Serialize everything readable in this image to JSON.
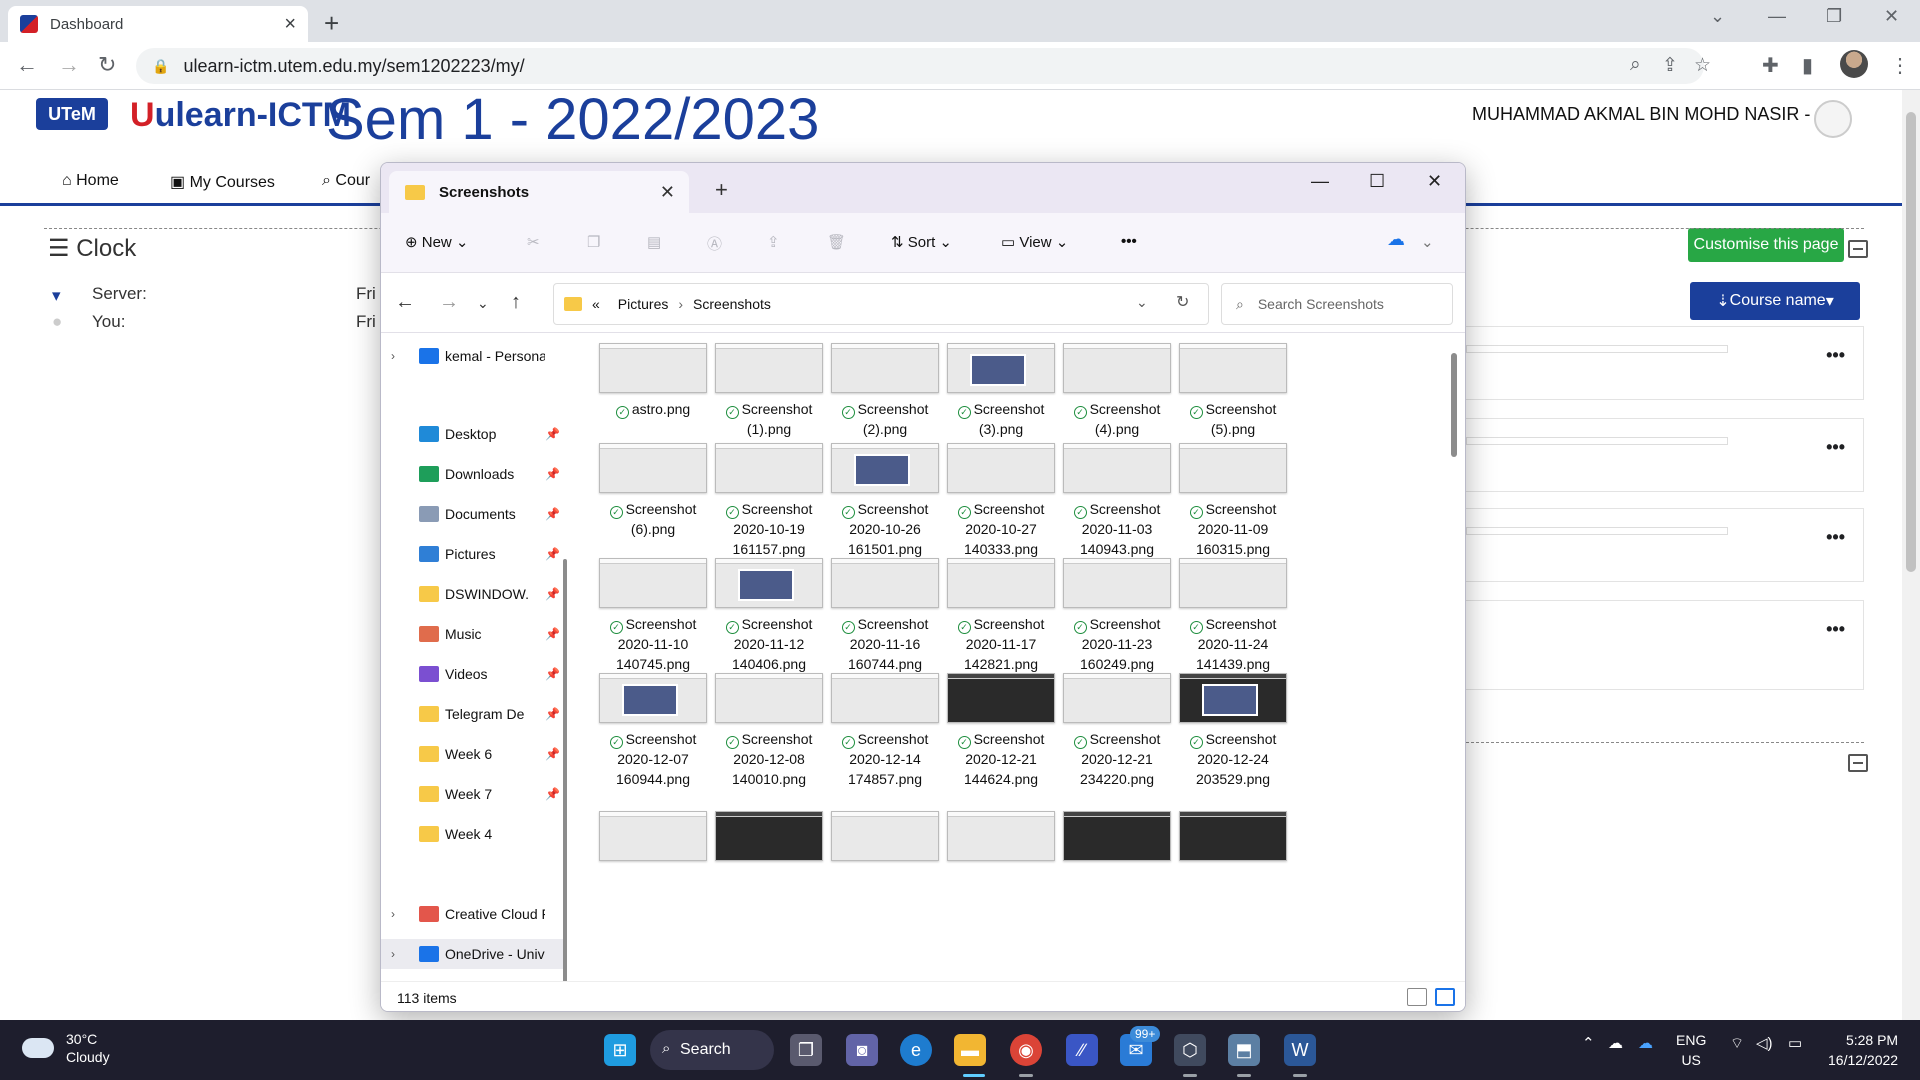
{
  "browser": {
    "tab_title": "Dashboard",
    "new_tab": "+",
    "url": "ulearn-ictm.utem.edu.my/sem1202223/my/"
  },
  "site": {
    "logo_text": "UTeM",
    "brand": "ulearn-ICTM",
    "brand_mark": "U",
    "semester_title": "Sem 1 - 2022/2023",
    "user_name": "MUHAMMAD AKMAL BIN MOHD NASIR -",
    "menu": [
      "Home",
      "My Courses",
      "Cour"
    ],
    "customise_label": "Customise this page",
    "clock": {
      "title": "Clock",
      "server_label": "Server:",
      "server_value": "Fri",
      "you_label": "You:",
      "you_value": "Fri"
    },
    "sort_label": "Course name",
    "course_more": "•••"
  },
  "explorer": {
    "tab_title": "Screenshots",
    "commands": {
      "new": "New",
      "sort": "Sort",
      "view": "View",
      "more": "•••"
    },
    "breadcrumb": {
      "prefix": "«",
      "parent": "Pictures",
      "current": "Screenshots"
    },
    "search_placeholder": "Search Screenshots",
    "nav": [
      {
        "label": "kemal - Persona",
        "color": "#1a73e8",
        "chev": true,
        "pin": false
      },
      {
        "label": "Desktop",
        "color": "#1f8ad8",
        "chev": false,
        "pin": true
      },
      {
        "label": "Downloads",
        "color": "#1e9e5a",
        "chev": false,
        "pin": true
      },
      {
        "label": "Documents",
        "color": "#8a9bb5",
        "chev": false,
        "pin": true
      },
      {
        "label": "Pictures",
        "color": "#2f7fd6",
        "chev": false,
        "pin": true
      },
      {
        "label": "DSWINDOW.",
        "color": "#f7c948",
        "chev": false,
        "pin": true
      },
      {
        "label": "Music",
        "color": "#e06c4c",
        "chev": false,
        "pin": true
      },
      {
        "label": "Videos",
        "color": "#7b4fd1",
        "chev": false,
        "pin": true
      },
      {
        "label": "Telegram De",
        "color": "#f7c948",
        "chev": false,
        "pin": true
      },
      {
        "label": "Week 6",
        "color": "#f7c948",
        "chev": false,
        "pin": true
      },
      {
        "label": "Week 7",
        "color": "#f7c948",
        "chev": false,
        "pin": true
      },
      {
        "label": "Week 4",
        "color": "#f7c948",
        "chev": false,
        "pin": false
      },
      {
        "label": "Creative Cloud F",
        "color": "#e3564b",
        "chev": true,
        "pin": false
      },
      {
        "label": "OneDrive - Univ",
        "color": "#1a73e8",
        "chev": true,
        "pin": false
      }
    ],
    "files": [
      {
        "l1": "astro.png",
        "l2": "",
        "l3": "",
        "dark": false
      },
      {
        "l1": "Screenshot",
        "l2": "(1).png",
        "l3": "",
        "dark": false
      },
      {
        "l1": "Screenshot",
        "l2": "(2).png",
        "l3": "",
        "dark": false
      },
      {
        "l1": "Screenshot",
        "l2": "(3).png",
        "l3": "",
        "dark": false
      },
      {
        "l1": "Screenshot",
        "l2": "(4).png",
        "l3": "",
        "dark": false
      },
      {
        "l1": "Screenshot",
        "l2": "(5).png",
        "l3": "",
        "dark": false
      },
      {
        "l1": "Screenshot",
        "l2": "(6).png",
        "l3": "",
        "dark": false
      },
      {
        "l1": "Screenshot",
        "l2": "2020-10-19",
        "l3": "161157.png",
        "dark": false
      },
      {
        "l1": "Screenshot",
        "l2": "2020-10-26",
        "l3": "161501.png",
        "dark": false
      },
      {
        "l1": "Screenshot",
        "l2": "2020-10-27",
        "l3": "140333.png",
        "dark": false
      },
      {
        "l1": "Screenshot",
        "l2": "2020-11-03",
        "l3": "140943.png",
        "dark": false
      },
      {
        "l1": "Screenshot",
        "l2": "2020-11-09",
        "l3": "160315.png",
        "dark": false
      },
      {
        "l1": "Screenshot",
        "l2": "2020-11-10",
        "l3": "140745.png",
        "dark": false
      },
      {
        "l1": "Screenshot",
        "l2": "2020-11-12",
        "l3": "140406.png",
        "dark": false
      },
      {
        "l1": "Screenshot",
        "l2": "2020-11-16",
        "l3": "160744.png",
        "dark": false
      },
      {
        "l1": "Screenshot",
        "l2": "2020-11-17",
        "l3": "142821.png",
        "dark": false
      },
      {
        "l1": "Screenshot",
        "l2": "2020-11-23",
        "l3": "160249.png",
        "dark": false
      },
      {
        "l1": "Screenshot",
        "l2": "2020-11-24",
        "l3": "141439.png",
        "dark": false
      },
      {
        "l1": "Screenshot",
        "l2": "2020-12-07",
        "l3": "160944.png",
        "dark": false
      },
      {
        "l1": "Screenshot",
        "l2": "2020-12-08",
        "l3": "140010.png",
        "dark": false
      },
      {
        "l1": "Screenshot",
        "l2": "2020-12-14",
        "l3": "174857.png",
        "dark": false
      },
      {
        "l1": "Screenshot",
        "l2": "2020-12-21",
        "l3": "144624.png",
        "dark": true
      },
      {
        "l1": "Screenshot",
        "l2": "2020-12-21",
        "l3": "234220.png",
        "dark": false
      },
      {
        "l1": "Screenshot",
        "l2": "2020-12-24",
        "l3": "203529.png",
        "dark": true
      }
    ],
    "partial_row_dark": [
      false,
      true,
      false,
      false,
      true,
      true
    ],
    "item_count": "113 items"
  },
  "taskbar": {
    "temperature": "30°C",
    "condition": "Cloudy",
    "search_label": "Search",
    "badge": "99+",
    "lang_1": "ENG",
    "lang_2": "US",
    "time": "5:28 PM",
    "date": "16/12/2022"
  }
}
